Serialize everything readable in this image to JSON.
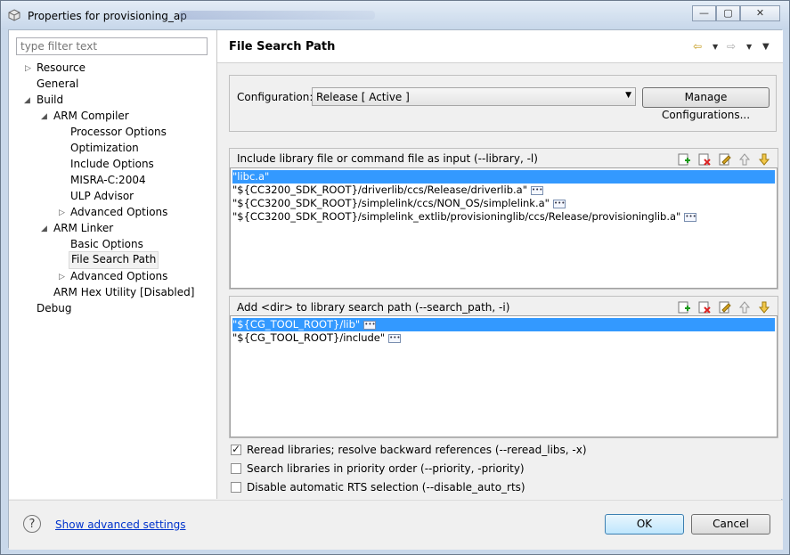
{
  "window": {
    "title": "Properties for provisioning_ap",
    "minimize_glyph": "—",
    "maximize_glyph": "▢",
    "close_glyph": "✕"
  },
  "filter": {
    "placeholder": "type filter text"
  },
  "tree": [
    {
      "label": "Resource"
    },
    {
      "label": "General"
    },
    {
      "label": "Build"
    },
    {
      "label": "ARM Compiler"
    },
    {
      "label": "Processor Options"
    },
    {
      "label": "Optimization"
    },
    {
      "label": "Include Options"
    },
    {
      "label": "MISRA-C:2004"
    },
    {
      "label": "ULP Advisor"
    },
    {
      "label": "Advanced Options"
    },
    {
      "label": "ARM Linker"
    },
    {
      "label": "Basic Options"
    },
    {
      "label": "File Search Path"
    },
    {
      "label": "Advanced Options"
    },
    {
      "label": "ARM Hex Utility  [Disabled]"
    },
    {
      "label": "Debug"
    }
  ],
  "page": {
    "title": "File Search Path"
  },
  "config": {
    "label": "Configuration:",
    "value": "Release  [ Active ]",
    "manage_label": "Manage Configurations..."
  },
  "library_list": {
    "header": "Include library file or command file as input (--library, -l)",
    "items": [
      "\"libc.a\"",
      "\"${CC3200_SDK_ROOT}/driverlib/ccs/Release/driverlib.a\"",
      "\"${CC3200_SDK_ROOT}/simplelink/ccs/NON_OS/simplelink.a\"",
      "\"${CC3200_SDK_ROOT}/simplelink_extlib/provisioninglib/ccs/Release/provisioninglib.a\""
    ]
  },
  "search_path_list": {
    "header": "Add <dir> to library search path (--search_path, -i)",
    "items": [
      "\"${CG_TOOL_ROOT}/lib\"",
      "\"${CG_TOOL_ROOT}/include\""
    ]
  },
  "options": [
    {
      "label": "Reread libraries; resolve backward references (--reread_libs, -x)",
      "checked": true
    },
    {
      "label": "Search libraries in priority order (--priority, -priority)",
      "checked": false
    },
    {
      "label": "Disable automatic RTS selection (--disable_auto_rts)",
      "checked": false
    }
  ],
  "footer": {
    "help_glyph": "?",
    "advanced_link": "Show advanced settings",
    "ok_label": "OK",
    "cancel_label": "Cancel"
  },
  "colors": {
    "selection": "#3399ff",
    "link": "#0033cc",
    "nav_arrow": "#c49a1a"
  }
}
